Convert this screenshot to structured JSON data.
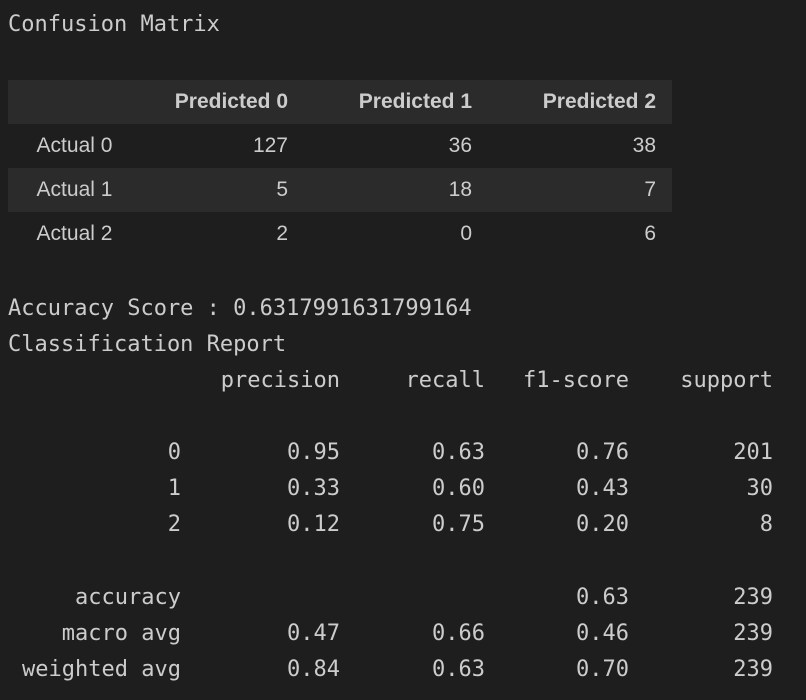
{
  "title": "Confusion Matrix",
  "confusion_matrix": {
    "columns": [
      "",
      "Predicted 0",
      "Predicted 1",
      "Predicted 2"
    ],
    "rows": [
      {
        "label": "Actual 0",
        "values": [
          "127",
          "36",
          "38"
        ]
      },
      {
        "label": "Actual 1",
        "values": [
          "5",
          "18",
          "7"
        ]
      },
      {
        "label": "Actual 2",
        "values": [
          "2",
          "0",
          "6"
        ]
      }
    ]
  },
  "accuracy_line": "Accuracy Score : 0.6317991631799164",
  "report_title": "Classification Report",
  "report": {
    "headers": [
      "precision",
      "recall",
      "f1-score",
      "support"
    ],
    "class_rows": [
      {
        "label": "0",
        "precision": "0.95",
        "recall": "0.63",
        "f1": "0.76",
        "support": "201"
      },
      {
        "label": "1",
        "precision": "0.33",
        "recall": "0.60",
        "f1": "0.43",
        "support": "30"
      },
      {
        "label": "2",
        "precision": "0.12",
        "recall": "0.75",
        "f1": "0.20",
        "support": "8"
      }
    ],
    "summary_rows": [
      {
        "label": "accuracy",
        "precision": "",
        "recall": "",
        "f1": "0.63",
        "support": "239"
      },
      {
        "label": "macro avg",
        "precision": "0.47",
        "recall": "0.66",
        "f1": "0.46",
        "support": "239"
      },
      {
        "label": "weighted avg",
        "precision": "0.84",
        "recall": "0.63",
        "f1": "0.70",
        "support": "239"
      }
    ]
  }
}
